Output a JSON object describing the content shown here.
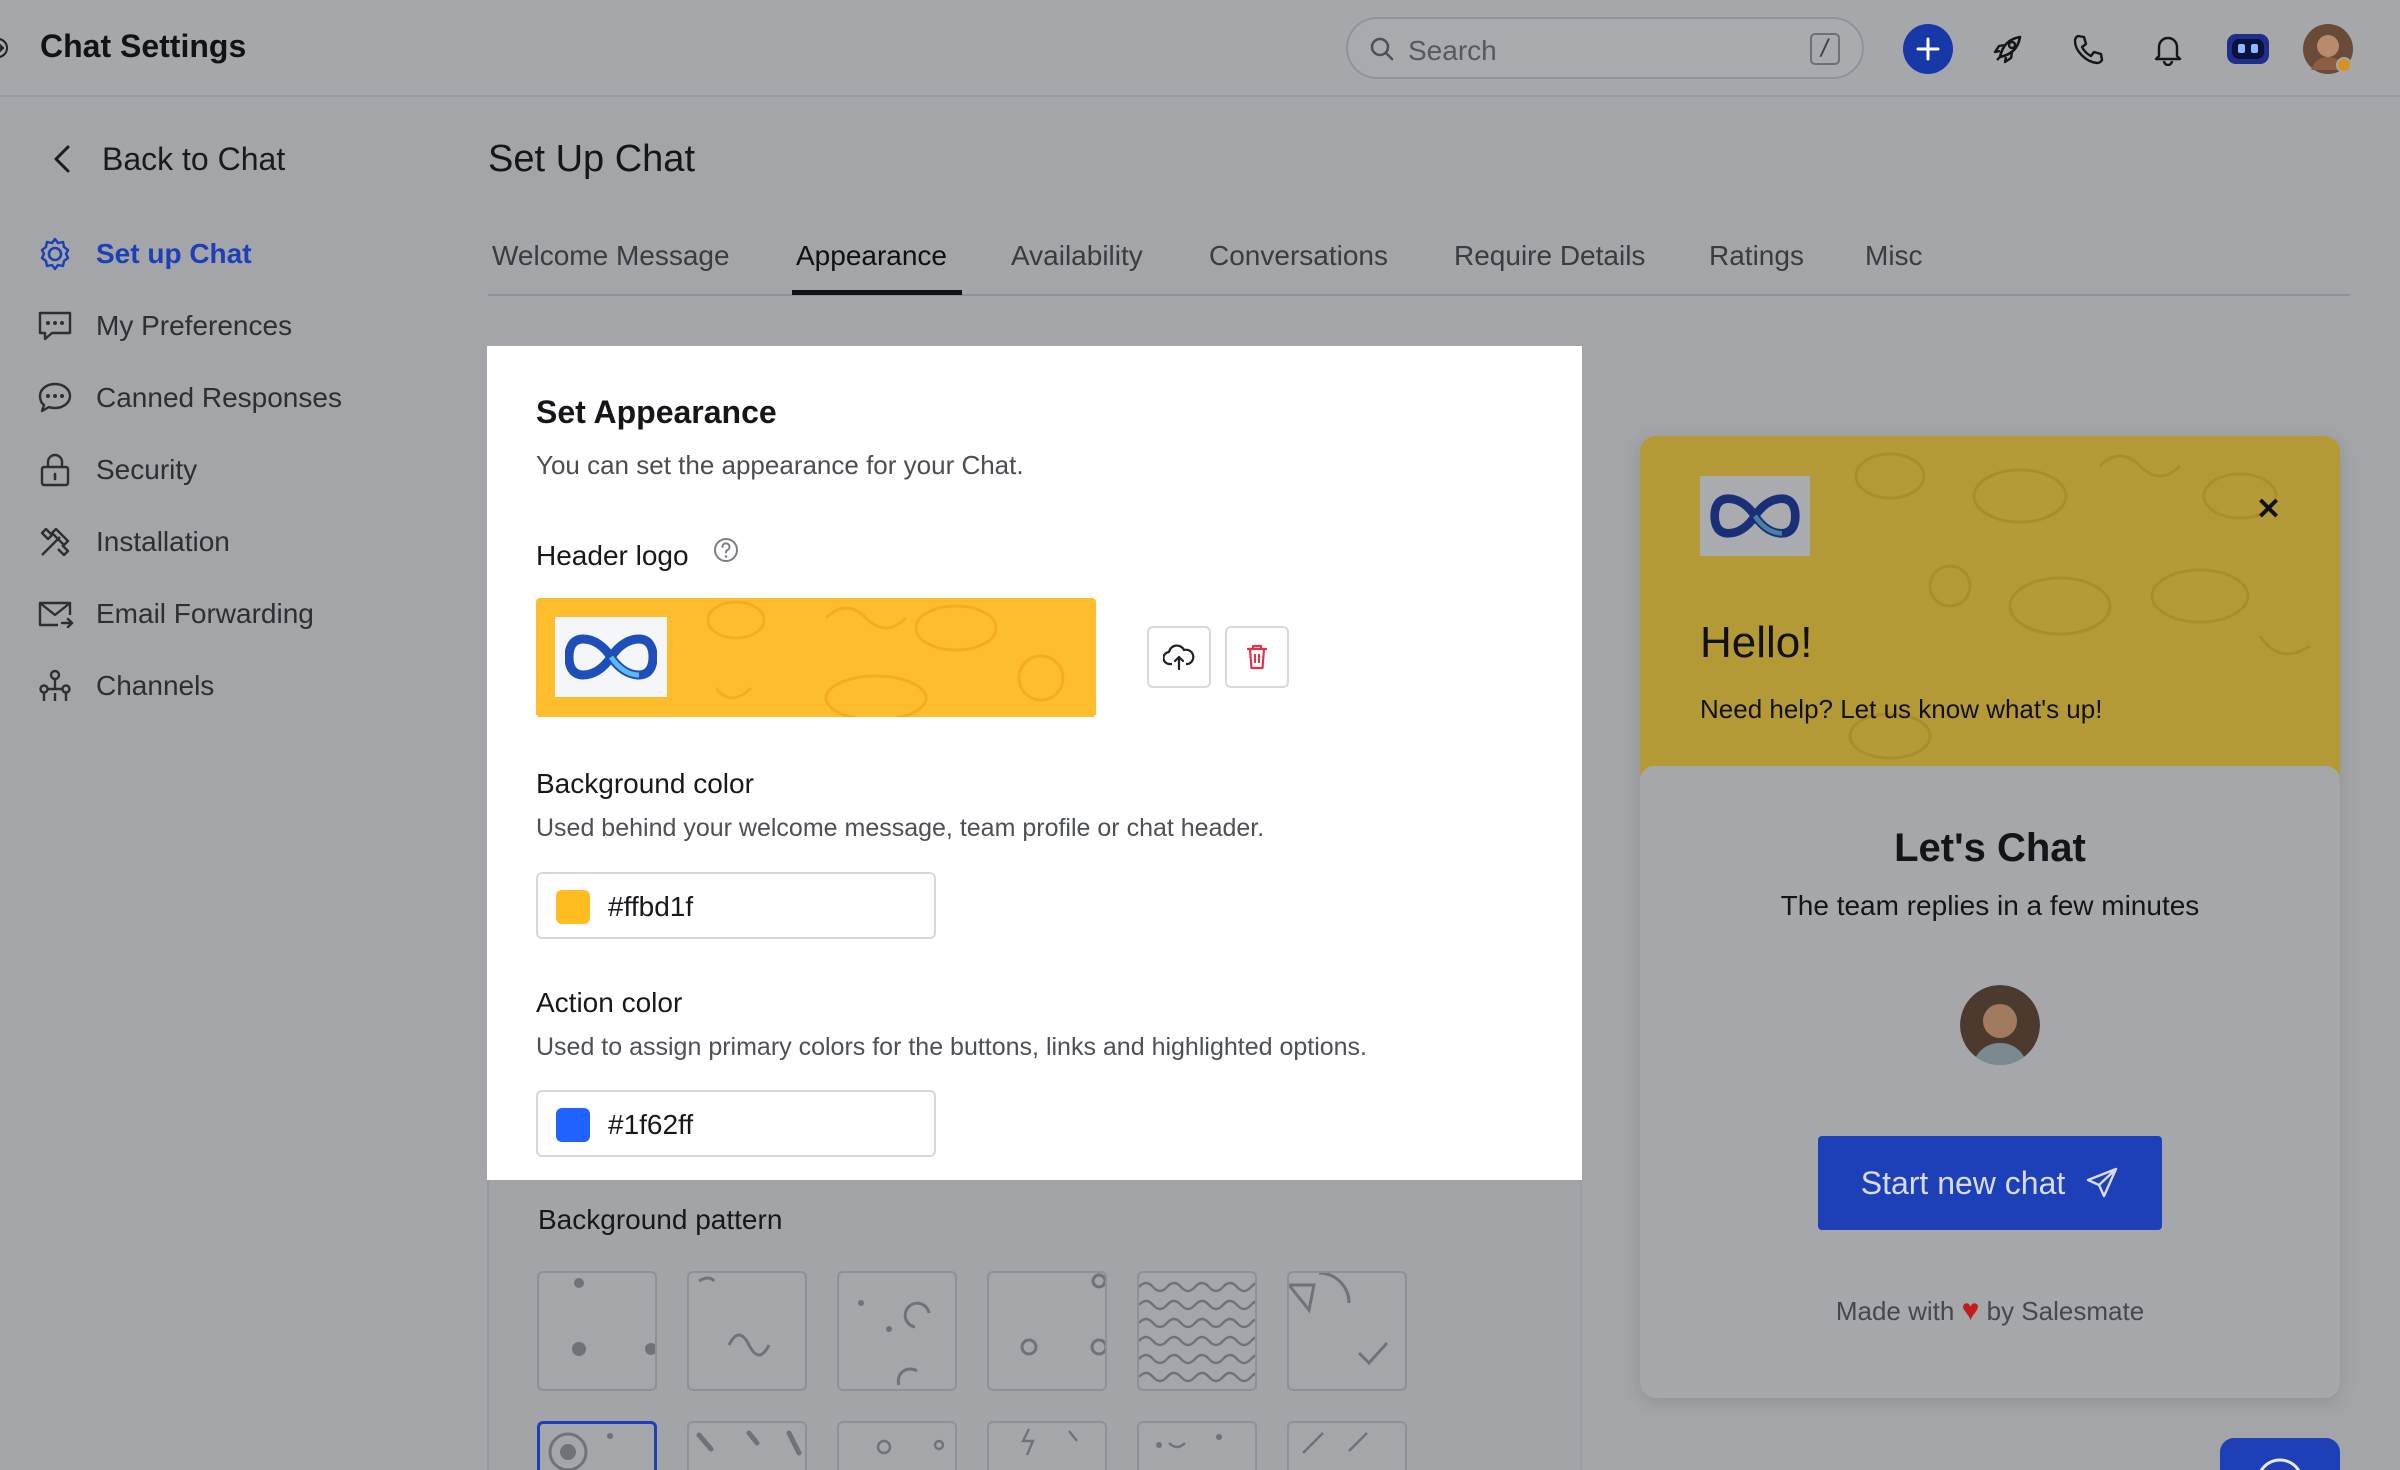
{
  "app": {
    "title": "Chat Settings"
  },
  "search": {
    "placeholder": "Search",
    "shortcut": "/"
  },
  "sidebar": {
    "back_label": "Back to Chat",
    "items": [
      {
        "label": "Set up Chat",
        "icon": "gear-icon",
        "active": true
      },
      {
        "label": "My Preferences",
        "icon": "chat-settings-icon",
        "active": false
      },
      {
        "label": "Canned Responses",
        "icon": "speech-bubble-icon",
        "active": false
      },
      {
        "label": "Security",
        "icon": "lock-icon",
        "active": false
      },
      {
        "label": "Installation",
        "icon": "tools-icon",
        "active": false
      },
      {
        "label": "Email Forwarding",
        "icon": "mail-forward-icon",
        "active": false
      },
      {
        "label": "Channels",
        "icon": "channels-icon",
        "active": false
      }
    ]
  },
  "main": {
    "title": "Set Up Chat",
    "tabs": [
      "Welcome Message",
      "Appearance",
      "Availability",
      "Conversations",
      "Require Details",
      "Ratings",
      "Misc"
    ],
    "active_tab": "Appearance"
  },
  "appearance": {
    "title": "Set Appearance",
    "subtitle": "You can set the appearance for your Chat.",
    "header_logo_label": "Header logo",
    "background_color": {
      "label": "Background color",
      "description": "Used behind your welcome message, team profile or chat header.",
      "value": "#ffbd1f"
    },
    "action_color": {
      "label": "Action color",
      "description": "Used to assign primary colors for the buttons, links and highlighted options.",
      "value": "#1f62ff"
    },
    "pattern_label": "Background pattern"
  },
  "preview": {
    "greeting": "Hello!",
    "help_text": "Need help? Let us know what's up!",
    "lets_chat": "Let's Chat",
    "reply_time": "The team replies in a few minutes",
    "start_button": "Start new chat",
    "made_with_prefix": "Made with",
    "made_with_suffix": "by Salesmate"
  },
  "colors": {
    "accent": "#1d3fb7",
    "header_yellow": "#ffbd2e"
  }
}
